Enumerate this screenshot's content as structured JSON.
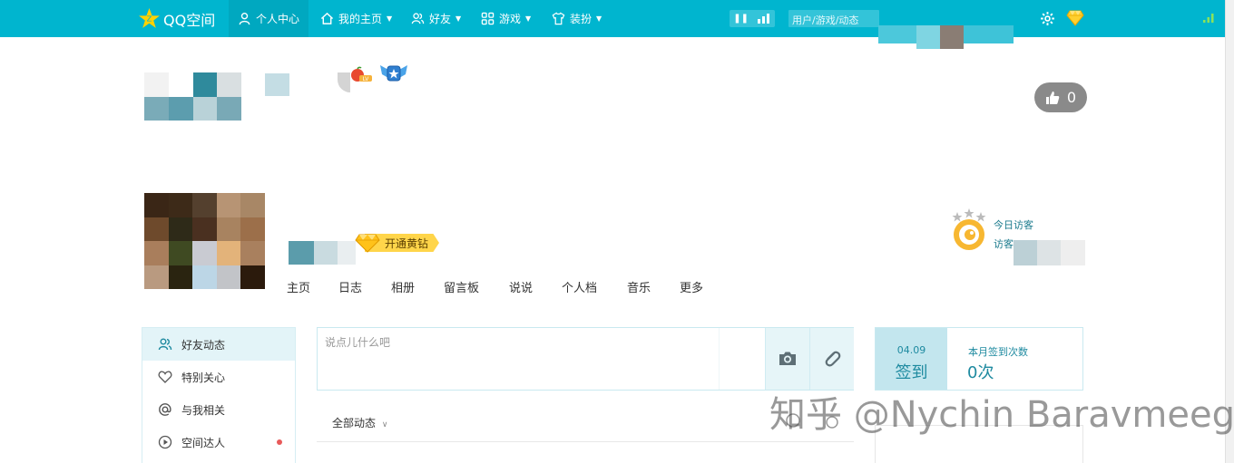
{
  "topbar": {
    "logo_text": "QQ空间",
    "nav": [
      {
        "label": "个人中心",
        "icon": "person-icon"
      },
      {
        "label": "我的主页",
        "icon": "home-icon"
      },
      {
        "label": "好友",
        "icon": "friends-icon"
      },
      {
        "label": "游戏",
        "icon": "grid-icon"
      },
      {
        "label": "装扮",
        "icon": "shirt-icon"
      }
    ],
    "search_placeholder": "用户/游戏/动态",
    "colors": {
      "bar": "#00b5cf",
      "accent": "#ffd54a"
    }
  },
  "profile": {
    "like_count": "0",
    "vip_button": "开通黄钻",
    "tabs": [
      "主页",
      "日志",
      "相册",
      "留言板",
      "说说",
      "个人档",
      "音乐",
      "更多"
    ],
    "visitor_today": "今日访客",
    "visitor_total": "访客"
  },
  "sidebar": {
    "items": [
      {
        "label": "好友动态",
        "icon": "friends-icon"
      },
      {
        "label": "特别关心",
        "icon": "heart-icon"
      },
      {
        "label": "与我相关",
        "icon": "at-icon"
      },
      {
        "label": "空间达人",
        "icon": "play-icon"
      }
    ]
  },
  "composer": {
    "placeholder": "说点儿什么吧",
    "filter": "全部动态"
  },
  "signin": {
    "date": "04.09",
    "button": "签到",
    "month_label": "本月签到次数",
    "month_count": "0次"
  },
  "watermark": "知乎 @Nychin Baravmeeg"
}
